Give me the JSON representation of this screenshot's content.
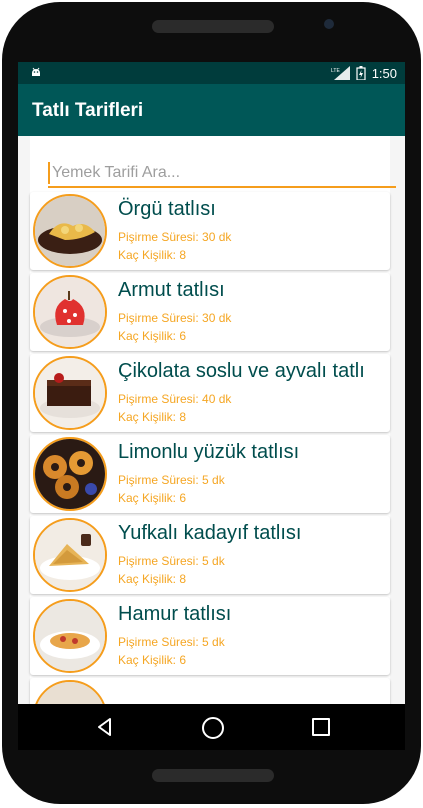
{
  "status_bar": {
    "network": "LTE",
    "time": "1:50"
  },
  "app_bar": {
    "title": "Tatlı Tarifleri"
  },
  "search": {
    "placeholder": "Yemek Tarifi Ara..."
  },
  "recipes": [
    {
      "name": "Örgü tatlısı",
      "cook_time": "Pişirme Süresi: 30 dk",
      "servings": "Kaç Kişilik: 8",
      "image": "orgu-tatlisi-photo"
    },
    {
      "name": "Armut tatlısı",
      "cook_time": "Pişirme Süresi: 30 dk",
      "servings": "Kaç Kişilik: 6",
      "image": "armut-tatlisi-photo"
    },
    {
      "name": "Çikolata soslu ve ayvalı tatlı",
      "cook_time": "Pişirme Süresi: 40 dk",
      "servings": "Kaç Kişilik: 8",
      "image": "cikolata-soslu-tatli-photo"
    },
    {
      "name": "Limonlu yüzük tatlısı",
      "cook_time": "Pişirme Süresi: 5 dk",
      "servings": "Kaç Kişilik: 6",
      "image": "limonlu-yuzuk-tatlisi-photo"
    },
    {
      "name": "Yufkalı kadayıf tatlısı",
      "cook_time": "Pişirme Süresi: 5 dk",
      "servings": "Kaç Kişilik: 8",
      "image": "yufkali-kadayif-photo"
    },
    {
      "name": "Hamur tatlısı",
      "cook_time": "Pişirme Süresi: 5 dk",
      "servings": "Kaç Kişilik: 6",
      "image": "hamur-tatlisi-photo"
    }
  ],
  "colors": {
    "status_bar": "#003c3c",
    "app_bar": "#005757",
    "accent": "#f59d1c",
    "title_text": "#004d4d"
  }
}
